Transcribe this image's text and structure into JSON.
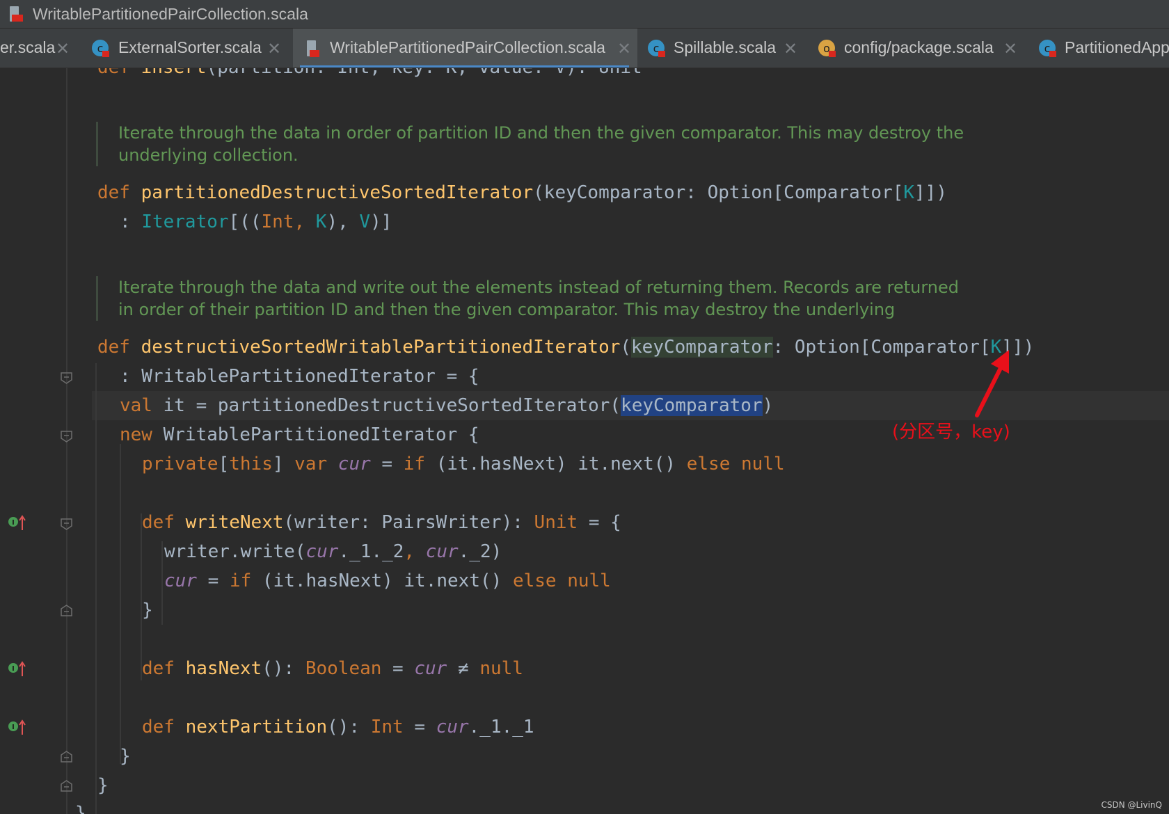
{
  "window": {
    "title": "WritablePartitionedPairCollection.scala"
  },
  "tabs": [
    {
      "label": "er.scala",
      "active": false
    },
    {
      "label": "ExternalSorter.scala",
      "active": false
    },
    {
      "label": "WritablePartitionedPairCollection.scala",
      "active": true
    },
    {
      "label": "Spillable.scala",
      "active": false
    },
    {
      "label": "config/package.scala",
      "active": false
    },
    {
      "label": "PartitionedApp",
      "active": false
    }
  ],
  "docs": [
    [
      "Iterate through the data in order of partition ID and then the given comparator. This may destroy the",
      "underlying collection."
    ],
    [
      "Iterate through the data and write out the elements instead of returning them. Records are returned",
      "in order of their partition ID and then the given comparator. This may destroy the underlying"
    ]
  ],
  "code": {
    "l0": {
      "def": "def",
      "name": "insert",
      "sig": "(partition: Int, key: K, value: V): Unit"
    },
    "l1": {
      "def": "def",
      "name": "partitionedDestructiveSortedIterator",
      "open": "(keyComparator: Option[Comparator[",
      "k": "K",
      "close": "]])"
    },
    "l2": {
      "colon": ": ",
      "iter": "Iterator",
      "b1": "[((",
      "int": "Int",
      "comma1": ", ",
      "k": "K",
      "b2": "), ",
      "v": "V",
      "b3": ")]"
    },
    "l3": {
      "def": "def",
      "name": "destructiveSortedWritablePartitionedIterator",
      "paren": "(",
      "param": "keyComparator",
      "rest": ": Option[Comparator[",
      "k": "K",
      "close": "]])"
    },
    "l4": {
      "text": ": WritablePartitionedIterator = {"
    },
    "l5": {
      "val": "val",
      "mid": " it = partitionedDestructiveSortedIterator(",
      "sel": "keyComparator",
      "close": ")"
    },
    "l6": {
      "new": "new",
      "rest": " WritablePartitionedIterator {"
    },
    "l7": {
      "priv": "private",
      "b1": "[",
      "this": "this",
      "b2": "] ",
      "var": "var",
      "sp": " ",
      "cur": "cur",
      "eq": " = ",
      "if": "if",
      "cond": " (it.hasNext) it.next() ",
      "else": "else",
      "sp2": " ",
      "null": "null"
    },
    "l8": {
      "def": "def",
      "name": "writeNext",
      "params": "(writer: PairsWriter): ",
      "unit": "Unit",
      "rest": " = {"
    },
    "l9": {
      "a": "writer.write(",
      "cur1": "cur",
      "b": "._1._2",
      "comma": ", ",
      "cur2": "cur",
      "c": "._2)"
    },
    "l10": {
      "cur": "cur",
      "eq": " = ",
      "if": "if",
      "cond": " (it.hasNext) it.next() ",
      "else": "else",
      "sp": " ",
      "null": "null"
    },
    "l11": {
      "text": "}"
    },
    "l12": {
      "def": "def",
      "name": "hasNext",
      "p": "(): ",
      "bool": "Boolean",
      "eq": " = ",
      "cur": "cur",
      "ne": " ≠ ",
      "null": "null"
    },
    "l13": {
      "def": "def",
      "name": "nextPartition",
      "p": "(): ",
      "int": "Int",
      "eq": " = ",
      "cur": "cur",
      "rest": "._1._1"
    },
    "l14": {
      "text": "}"
    },
    "l15": {
      "text": "}"
    },
    "l16": {
      "text": "}"
    }
  },
  "annotation": {
    "text": "(分区号，key)"
  },
  "watermark": "CSDN @LivinQ",
  "colors": {
    "background": "#2b2b2b",
    "keyword": "#cc7832",
    "function": "#ffc66d",
    "doc_comment": "#629755",
    "type_param": "#20999d",
    "field": "#9876aa",
    "selection": "#214283",
    "annotation": "#e8101a",
    "tab_underline": "#4a88c7"
  }
}
